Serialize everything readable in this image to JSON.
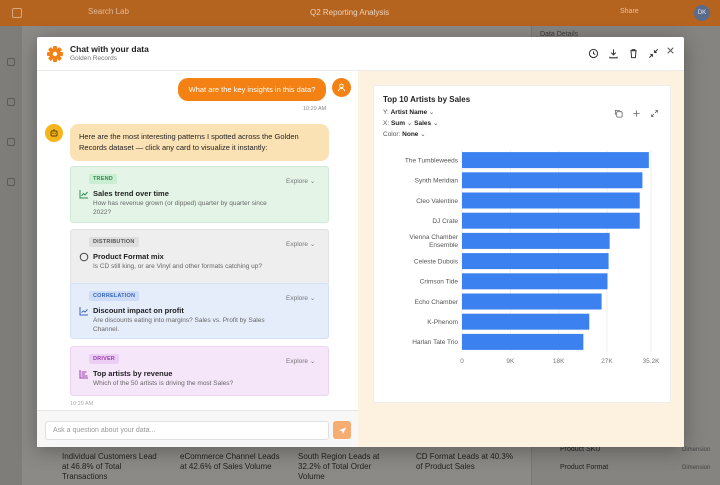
{
  "background": {
    "search_placeholder": "Search Lab",
    "doc_title": "Q2 Reporting Analysis",
    "share_label": "Share",
    "avatar_initials": "DK",
    "panel_title": "Data Details",
    "panel_rows": [
      {
        "label": "Product SKU",
        "type": "Dimension"
      },
      {
        "label": "Product Format",
        "type": "Dimension"
      }
    ],
    "bottom_texts": [
      "Individual Customers Lead at 46.8% of Total Transactions",
      "eCommerce Channel Leads at 42.6% of Sales Volume",
      "South Region Leads at 32.2% of Total Order Volume",
      "CD Format Leads at 40.3% of Product Sales"
    ]
  },
  "modal": {
    "title": "Chat with your data",
    "subtitle": "Golden Records",
    "header_icons": [
      "history-icon",
      "download-icon",
      "trash-icon",
      "collapse-icon",
      "close-icon"
    ]
  },
  "chat": {
    "user_message": "What are the key insights in this data?",
    "user_time": "10:29 AM",
    "bot_intro": "Here are the most interesting patterns I spotted across the Golden Records dataset — click any card to visualize it instantly:",
    "bot_time": "10:29 AM",
    "cards": [
      {
        "badge": "TREND",
        "title": "Sales trend over time",
        "desc": "How has revenue grown (or dipped) quarter by quarter since 2022?",
        "explore": "Explore",
        "icon": "line-chart-icon",
        "bg": "#e4f5e8",
        "border": "#cfe9d6",
        "badge_bg": "#c9eed2",
        "badge_fg": "#2e8b4e",
        "icon_color": "#2e8b4e"
      },
      {
        "badge": "DISTRIBUTION",
        "title": "Product Format mix",
        "desc": "Is CD still king, or are Vinyl and other formats catching up?",
        "explore": "Explore",
        "icon": "pie-chart-icon",
        "bg": "#eeeeee",
        "border": "#e2e2e2",
        "badge_bg": "#dedede",
        "badge_fg": "#555555",
        "icon_color": "#444444"
      },
      {
        "badge": "CORRELATION",
        "title": "Discount impact on profit",
        "desc": "Are discounts eating into margins? Sales vs. Profit by Sales Channel.",
        "explore": "Explore",
        "icon": "scatter-chart-icon",
        "bg": "#e5edfb",
        "border": "#d3e0f6",
        "badge_bg": "#cddcf7",
        "badge_fg": "#3a65b8",
        "icon_color": "#3a65b8"
      },
      {
        "badge": "DRIVER",
        "title": "Top artists by revenue",
        "desc": "Which of the 50 artists is driving the most Sales?",
        "explore": "Explore",
        "icon": "bar-chart-icon",
        "bg": "#f6e6fa",
        "border": "#ecd5f2",
        "badge_bg": "#eccdf4",
        "badge_fg": "#9a3eb0",
        "icon_color": "#9a3eb0"
      }
    ],
    "input_placeholder": "Ask a question about your data..."
  },
  "viz": {
    "y_label": "Y:",
    "y_value": "Artist Name",
    "x_label": "X:",
    "x_agg": "Sum",
    "x_value": "Sales",
    "color_label": "Color:",
    "color_value": "None",
    "bar_color": "#3b82f0"
  },
  "chart_data": {
    "type": "bar",
    "orientation": "horizontal",
    "title": "Top 10 Artists by Sales",
    "categories": [
      "The Tumbleweeds",
      "Synth Meridian",
      "Cleo Valentine",
      "DJ Crate",
      "Vienna Chamber Ensemble",
      "Celeste Dubois",
      "Crimson Tide",
      "Echo Chamber",
      "K-Phenom",
      "Harlan Tate Trio"
    ],
    "values": [
      34800,
      33600,
      33100,
      33100,
      27500,
      27300,
      27100,
      26000,
      23700,
      22600
    ],
    "xlim": [
      0,
      35200
    ],
    "xticks": [
      0,
      9000,
      18000,
      27000,
      35200
    ],
    "xtick_labels": [
      "0",
      "9K",
      "18K",
      "27K",
      "35.2K"
    ],
    "grid": true
  }
}
